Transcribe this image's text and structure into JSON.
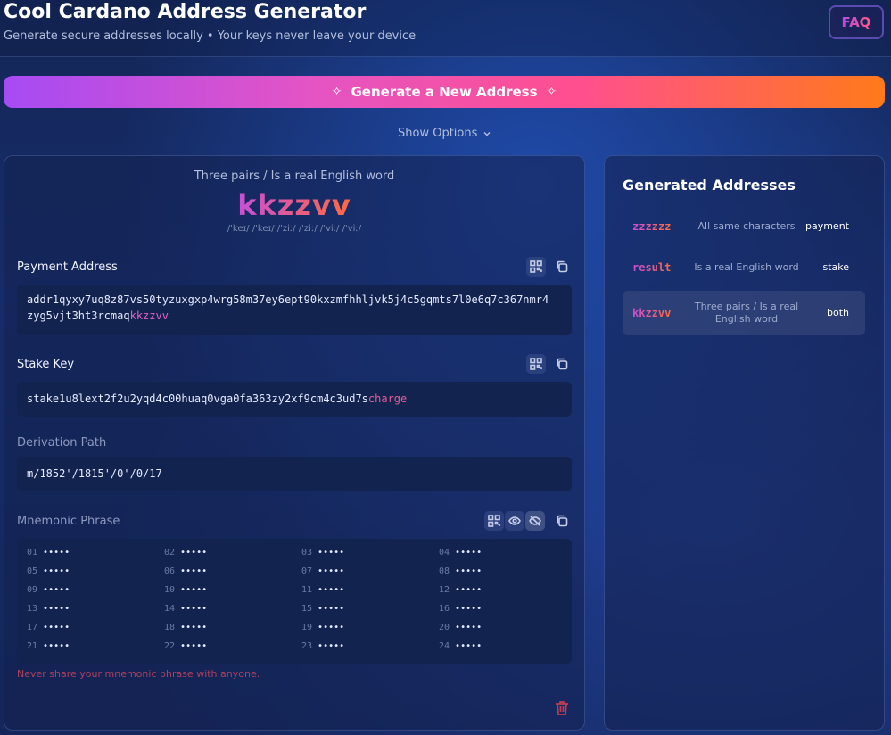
{
  "header": {
    "title": "Cool Cardano Address Generator",
    "subtitle": "Generate secure addresses locally • Your keys never leave your device",
    "faq_label": "FAQ"
  },
  "generate_button": {
    "label": "Generate a New Address"
  },
  "show_options_label": "Show Options",
  "current": {
    "pattern_desc": "Three pairs / Is a real English word",
    "word": "kkzzvv",
    "ipa": "/'keɪ/ /'keɪ/ /'ziː/ /'ziː/ /'viː/ /'viː/"
  },
  "payment": {
    "label": "Payment Address",
    "line1": "addr1qyxy7uq8z87vs50tyzuxgxp4wrg58m37ey6ept90kxzmfhhljvk5j4c5gqmts7l0e6q7c367nmr4",
    "line2_prefix": "zyg5vjt3ht3rcmaq",
    "line2_highlight": "kkzzvv"
  },
  "stake": {
    "label": "Stake Key",
    "prefix": "stake1u8lext2f2u2yqd4c00huaq0vga0fa363zy2xf9cm4c3ud7s",
    "highlight": "charge"
  },
  "derivation": {
    "label": "Derivation Path",
    "value": "m/1852'/1815'/0'/0/17"
  },
  "mnemonic": {
    "label": "Mnemonic Phrase",
    "masked": "•••••",
    "numbers": [
      "01",
      "02",
      "03",
      "04",
      "05",
      "06",
      "07",
      "08",
      "09",
      "10",
      "11",
      "12",
      "13",
      "14",
      "15",
      "16",
      "17",
      "18",
      "19",
      "20",
      "21",
      "22",
      "23",
      "24"
    ],
    "warning": "Never share your mnemonic phrase with anyone."
  },
  "generated": {
    "title": "Generated Addresses",
    "rows": [
      {
        "word": "zzzzzz",
        "desc": "All same characters",
        "type": "payment",
        "selected": false
      },
      {
        "word": "result",
        "desc": "Is a real English word",
        "type": "stake",
        "selected": false
      },
      {
        "word": "kkzzvv",
        "desc": "Three pairs / Is a real English word",
        "type": "both",
        "selected": true
      }
    ]
  },
  "icons": [
    "sparkle-icon",
    "chevron-down-icon",
    "qr-code-icon",
    "copy-icon",
    "eye-icon",
    "eye-off-icon",
    "trash-icon"
  ],
  "colors": {
    "accent_start": "#a64bf4",
    "accent_end": "#ff7a1a",
    "highlight": "#e060c8",
    "danger": "#c23a50"
  }
}
